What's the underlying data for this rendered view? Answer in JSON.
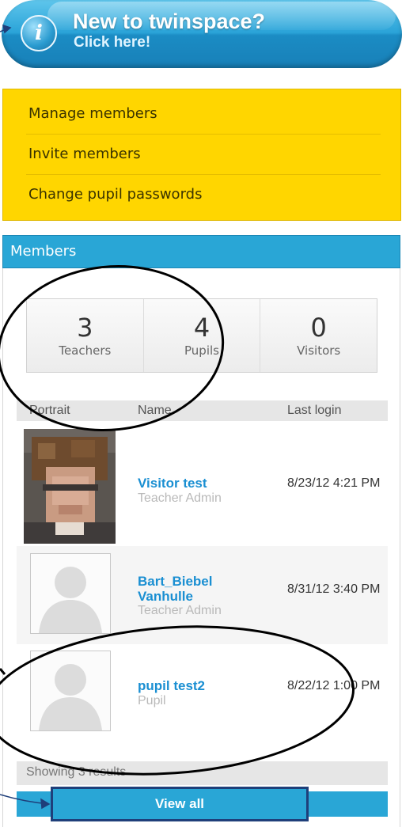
{
  "banner": {
    "title": "New to twinspace?",
    "subtitle": "Click here!",
    "icon": "info-icon",
    "icon_glyph": "i"
  },
  "menu": {
    "items": [
      {
        "label": "Manage members"
      },
      {
        "label": "Invite members"
      },
      {
        "label": "Change pupil passwords"
      }
    ]
  },
  "members": {
    "title": "Members",
    "stats": [
      {
        "count": "3",
        "label": "Teachers"
      },
      {
        "count": "4",
        "label": "Pupils"
      },
      {
        "count": "0",
        "label": "Visitors"
      }
    ],
    "columns": [
      "Portrait",
      "Name",
      "Last login"
    ],
    "rows": [
      {
        "name": "Visitor test",
        "role": "Teacher Admin",
        "last_login": "8/23/12 4:21 PM",
        "portrait": "pixelated-photo"
      },
      {
        "name": "Bart_Biebel Vanhulle",
        "role": "Teacher Admin",
        "last_login": "8/31/12 3:40 PM",
        "portrait": "default-avatar-icon"
      },
      {
        "name": "pupil test2",
        "role": "Pupil",
        "last_login": "8/22/12 1:00 PM",
        "portrait": "default-avatar-icon"
      }
    ],
    "results_text": "Showing 3 results",
    "view_all_label": "View all"
  },
  "colors": {
    "accent_blue": "#29a6d6",
    "menu_yellow": "#ffd600",
    "link_blue": "#1a8fd2",
    "annotation": "#000000",
    "highlight_box": "#1f3f7a"
  }
}
